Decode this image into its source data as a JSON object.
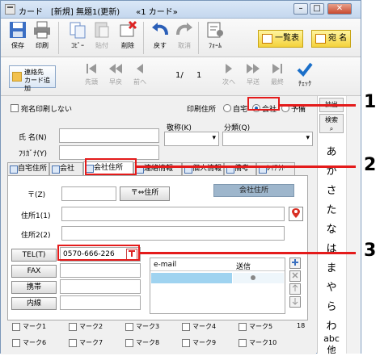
{
  "window": {
    "title": "カード　[新規]  無題1(更新)　　«1 カード»",
    "min_btn": "–",
    "max_btn": "□",
    "close_btn": "✕"
  },
  "toolbar": {
    "save": "保存",
    "print": "印刷",
    "copy": "ｺﾋﾟｰ",
    "paste": "貼付",
    "delete": "削除",
    "undo": "戻す",
    "redo": "取消",
    "form": "ﾌｫｰﾑ",
    "list": "一覧表",
    "atena": "宛 名"
  },
  "navbar": {
    "add_contact_l1": "連絡先",
    "add_contact_l2": "カード追加",
    "first": "先頭",
    "prev_fast": "早戻",
    "prev": "前へ",
    "page_current": "1/",
    "page_total": "1",
    "next": "次へ",
    "next_fast": "早送",
    "last": "最終",
    "check": "ﾁｪｯｸ"
  },
  "form": {
    "no_print_label": "宛名印刷しない",
    "print_addr_label": "印刷住所",
    "radio_home": "自宅",
    "radio_company": "会社",
    "radio_none": "予備",
    "name_label": "氏 名(N)",
    "furigana_label": "ﾌﾘｶﾞﾅ(Y)",
    "title_label": "敬称(K)",
    "category_label": "分類(Q)"
  },
  "tabs": [
    "自宅住所",
    "会社",
    "会社住所",
    "連絡情報",
    "個人情報",
    "備考",
    "ﾚｲｱｳﾄ"
  ],
  "panel": {
    "zip_label": "〒(Z)",
    "zip_btn": "〒⇔住所",
    "company_addr_btn": "会社住所",
    "addr1_label": "住所1(1)",
    "addr2_label": "住所2(2)",
    "tel_btn": "TEL(T)",
    "tel_value": "0570-666-226",
    "fax_btn": "FAX",
    "mobile_btn": "携帯",
    "ext_btn": "内線",
    "email_header": "e-mail",
    "send_header": "送信"
  },
  "marks": [
    "マーク1",
    "マーク2",
    "マーク3",
    "マーク4",
    "マーク5",
    "マーク6",
    "マーク7",
    "マーク8",
    "マーク9",
    "マーク10"
  ],
  "side": {
    "extract": "抽出",
    "search": "検索",
    "kana": [
      "あ",
      "か",
      "さ",
      "た",
      "な",
      "は",
      "ま",
      "や",
      "ら",
      "わ",
      "abc",
      "他"
    ],
    "counter": "18"
  },
  "callouts": [
    "1",
    "2",
    "3"
  ],
  "colors": {
    "accent_red": "#e41b1b",
    "title_bg": "#dbe8f7",
    "highlight_row": "#9fd3f0"
  }
}
